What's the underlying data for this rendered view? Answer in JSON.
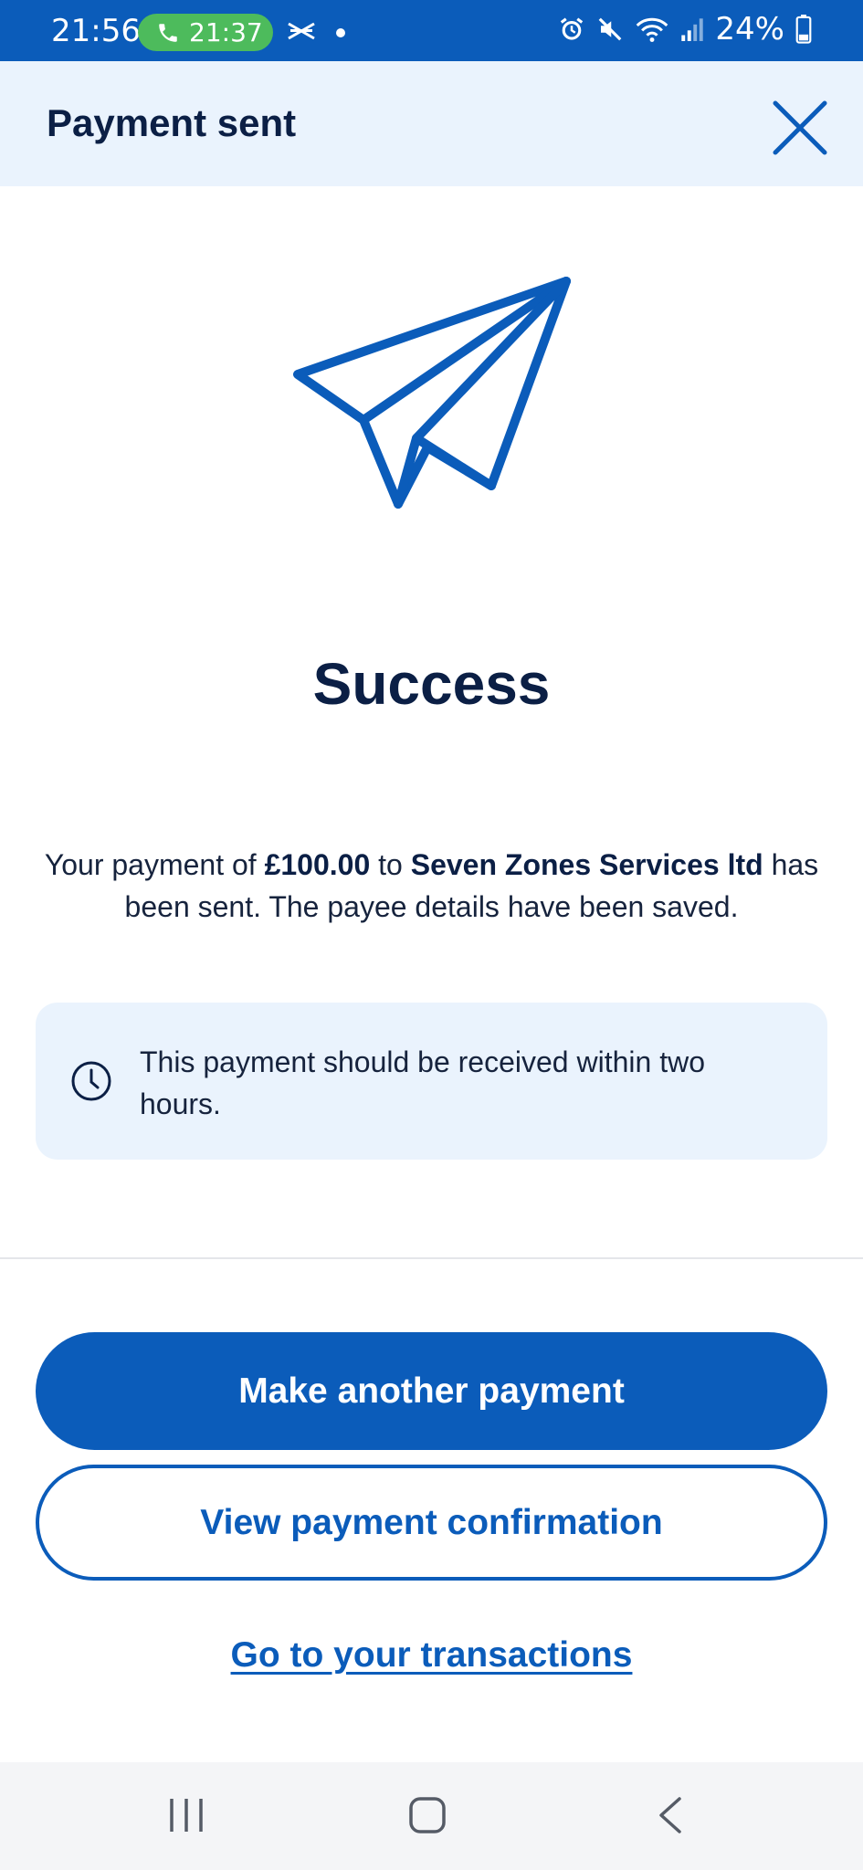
{
  "status_bar": {
    "time": "21:56",
    "call_time": "21:37",
    "battery": "24%"
  },
  "header": {
    "title": "Payment sent"
  },
  "main": {
    "heading": "Success",
    "message": {
      "part1": "Your payment of ",
      "amount": "£100.00",
      "part2": " to ",
      "payee": "Seven Zones Services ltd",
      "part3": " has been sent. The payee details have been saved."
    },
    "info": "This payment should be received within two hours."
  },
  "actions": {
    "primary": "Make another payment",
    "secondary": "View payment confirmation",
    "link": "Go to your transactions"
  },
  "colors": {
    "brand_blue": "#0b5cba",
    "header_bg": "#eaf3fd",
    "call_green": "#4dbb5c",
    "text_dark": "#0b1f45"
  },
  "icons": [
    "phone-icon",
    "halifax-logo-icon",
    "alarm-icon",
    "mute-icon",
    "wifi-icon",
    "signal-icon",
    "battery-icon",
    "close-icon",
    "paper-plane-icon",
    "clock-icon",
    "recent-apps-icon",
    "home-icon",
    "back-icon"
  ]
}
